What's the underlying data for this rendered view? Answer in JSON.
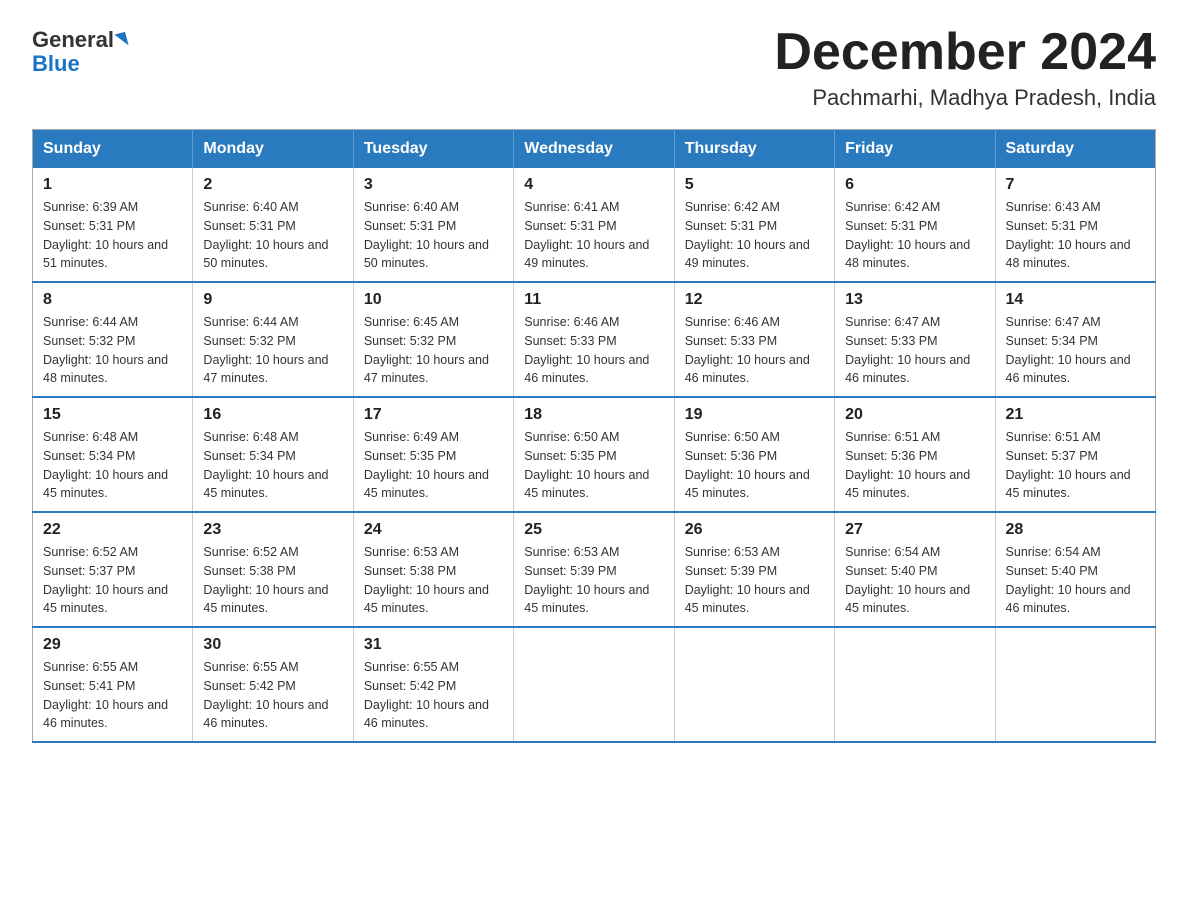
{
  "logo": {
    "text_general": "General",
    "text_blue": "Blue"
  },
  "title": "December 2024",
  "subtitle": "Pachmarhi, Madhya Pradesh, India",
  "header_days": [
    "Sunday",
    "Monday",
    "Tuesday",
    "Wednesday",
    "Thursday",
    "Friday",
    "Saturday"
  ],
  "weeks": [
    [
      {
        "day": "1",
        "sunrise": "6:39 AM",
        "sunset": "5:31 PM",
        "daylight": "10 hours and 51 minutes."
      },
      {
        "day": "2",
        "sunrise": "6:40 AM",
        "sunset": "5:31 PM",
        "daylight": "10 hours and 50 minutes."
      },
      {
        "day": "3",
        "sunrise": "6:40 AM",
        "sunset": "5:31 PM",
        "daylight": "10 hours and 50 minutes."
      },
      {
        "day": "4",
        "sunrise": "6:41 AM",
        "sunset": "5:31 PM",
        "daylight": "10 hours and 49 minutes."
      },
      {
        "day": "5",
        "sunrise": "6:42 AM",
        "sunset": "5:31 PM",
        "daylight": "10 hours and 49 minutes."
      },
      {
        "day": "6",
        "sunrise": "6:42 AM",
        "sunset": "5:31 PM",
        "daylight": "10 hours and 48 minutes."
      },
      {
        "day": "7",
        "sunrise": "6:43 AM",
        "sunset": "5:31 PM",
        "daylight": "10 hours and 48 minutes."
      }
    ],
    [
      {
        "day": "8",
        "sunrise": "6:44 AM",
        "sunset": "5:32 PM",
        "daylight": "10 hours and 48 minutes."
      },
      {
        "day": "9",
        "sunrise": "6:44 AM",
        "sunset": "5:32 PM",
        "daylight": "10 hours and 47 minutes."
      },
      {
        "day": "10",
        "sunrise": "6:45 AM",
        "sunset": "5:32 PM",
        "daylight": "10 hours and 47 minutes."
      },
      {
        "day": "11",
        "sunrise": "6:46 AM",
        "sunset": "5:33 PM",
        "daylight": "10 hours and 46 minutes."
      },
      {
        "day": "12",
        "sunrise": "6:46 AM",
        "sunset": "5:33 PM",
        "daylight": "10 hours and 46 minutes."
      },
      {
        "day": "13",
        "sunrise": "6:47 AM",
        "sunset": "5:33 PM",
        "daylight": "10 hours and 46 minutes."
      },
      {
        "day": "14",
        "sunrise": "6:47 AM",
        "sunset": "5:34 PM",
        "daylight": "10 hours and 46 minutes."
      }
    ],
    [
      {
        "day": "15",
        "sunrise": "6:48 AM",
        "sunset": "5:34 PM",
        "daylight": "10 hours and 45 minutes."
      },
      {
        "day": "16",
        "sunrise": "6:48 AM",
        "sunset": "5:34 PM",
        "daylight": "10 hours and 45 minutes."
      },
      {
        "day": "17",
        "sunrise": "6:49 AM",
        "sunset": "5:35 PM",
        "daylight": "10 hours and 45 minutes."
      },
      {
        "day": "18",
        "sunrise": "6:50 AM",
        "sunset": "5:35 PM",
        "daylight": "10 hours and 45 minutes."
      },
      {
        "day": "19",
        "sunrise": "6:50 AM",
        "sunset": "5:36 PM",
        "daylight": "10 hours and 45 minutes."
      },
      {
        "day": "20",
        "sunrise": "6:51 AM",
        "sunset": "5:36 PM",
        "daylight": "10 hours and 45 minutes."
      },
      {
        "day": "21",
        "sunrise": "6:51 AM",
        "sunset": "5:37 PM",
        "daylight": "10 hours and 45 minutes."
      }
    ],
    [
      {
        "day": "22",
        "sunrise": "6:52 AM",
        "sunset": "5:37 PM",
        "daylight": "10 hours and 45 minutes."
      },
      {
        "day": "23",
        "sunrise": "6:52 AM",
        "sunset": "5:38 PM",
        "daylight": "10 hours and 45 minutes."
      },
      {
        "day": "24",
        "sunrise": "6:53 AM",
        "sunset": "5:38 PM",
        "daylight": "10 hours and 45 minutes."
      },
      {
        "day": "25",
        "sunrise": "6:53 AM",
        "sunset": "5:39 PM",
        "daylight": "10 hours and 45 minutes."
      },
      {
        "day": "26",
        "sunrise": "6:53 AM",
        "sunset": "5:39 PM",
        "daylight": "10 hours and 45 minutes."
      },
      {
        "day": "27",
        "sunrise": "6:54 AM",
        "sunset": "5:40 PM",
        "daylight": "10 hours and 45 minutes."
      },
      {
        "day": "28",
        "sunrise": "6:54 AM",
        "sunset": "5:40 PM",
        "daylight": "10 hours and 46 minutes."
      }
    ],
    [
      {
        "day": "29",
        "sunrise": "6:55 AM",
        "sunset": "5:41 PM",
        "daylight": "10 hours and 46 minutes."
      },
      {
        "day": "30",
        "sunrise": "6:55 AM",
        "sunset": "5:42 PM",
        "daylight": "10 hours and 46 minutes."
      },
      {
        "day": "31",
        "sunrise": "6:55 AM",
        "sunset": "5:42 PM",
        "daylight": "10 hours and 46 minutes."
      },
      null,
      null,
      null,
      null
    ]
  ]
}
